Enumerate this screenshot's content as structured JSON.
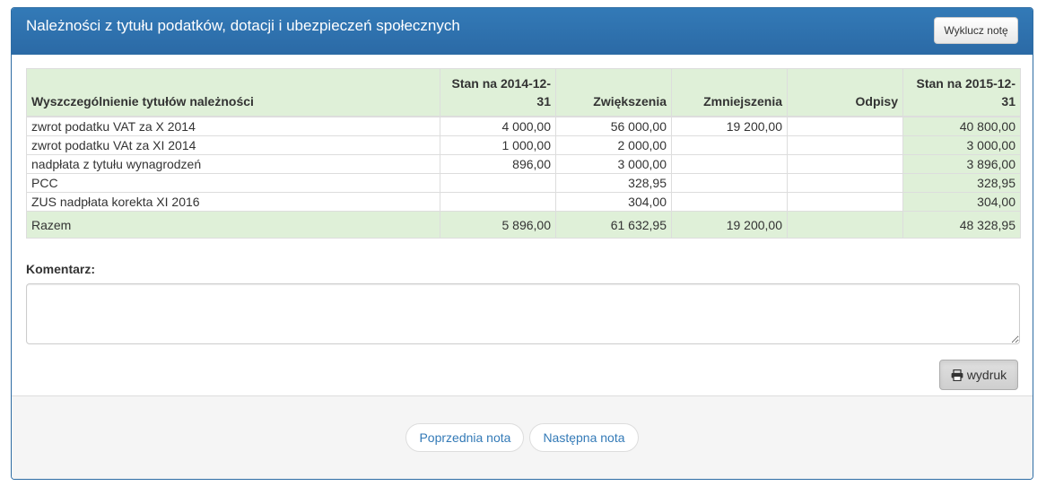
{
  "panel": {
    "title": "Należności z tytułu podatków, dotacji i ubezpieczeń społecznych",
    "exclude_button": "Wyklucz notę"
  },
  "table": {
    "headers": [
      "Wyszczególnienie tytułów należności",
      "Stan na 2014-12-31",
      "Zwiększenia",
      "Zmniejszenia",
      "Odpisy",
      "Stan na 2015-12-31"
    ],
    "rows": [
      [
        "zwrot podatku VAT za X 2014",
        "4 000,00",
        "56 000,00",
        "19 200,00",
        "",
        "40 800,00"
      ],
      [
        "zwrot podatku VAt za XI 2014",
        "1 000,00",
        "2 000,00",
        "",
        "",
        "3 000,00"
      ],
      [
        "nadpłata z tytułu wynagrodzeń",
        "896,00",
        "3 000,00",
        "",
        "",
        "3 896,00"
      ],
      [
        "PCC",
        "",
        "328,95",
        "",
        "",
        "328,95"
      ],
      [
        "ZUS  nadpłata korekta XI 2016",
        "",
        "304,00",
        "",
        "",
        "304,00"
      ]
    ],
    "total": [
      "Razem",
      "5 896,00",
      "61 632,95",
      "19 200,00",
      "",
      "48 328,95"
    ]
  },
  "comment": {
    "label": "Komentarz:",
    "value": ""
  },
  "print_button": "wydruk",
  "pager": {
    "prev": "Poprzednia nota",
    "next": "Następna nota"
  },
  "icons": {
    "print": "print-icon"
  }
}
